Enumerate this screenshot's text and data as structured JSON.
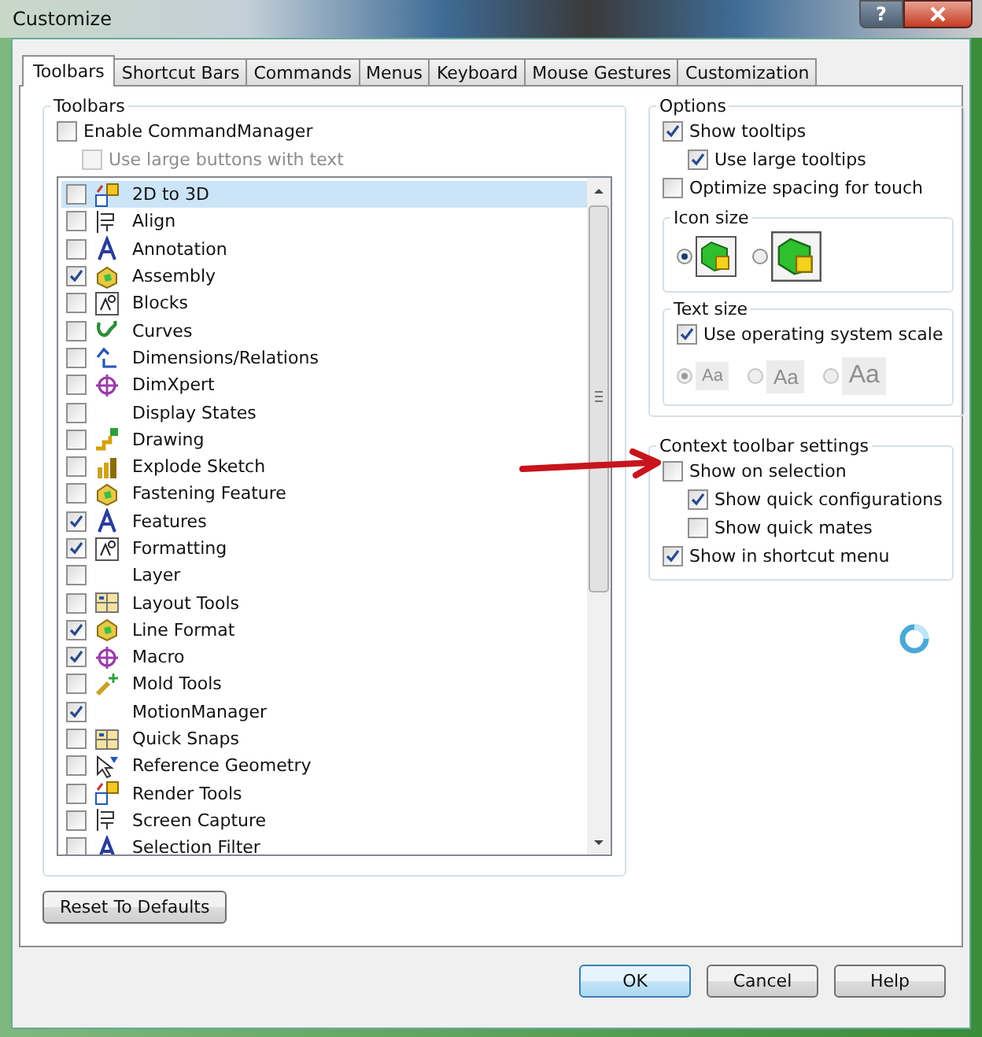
{
  "window": {
    "title": "Customize",
    "help_button": "?"
  },
  "tabs": [
    {
      "label": "Toolbars",
      "selected": true
    },
    {
      "label": "Shortcut Bars",
      "selected": false
    },
    {
      "label": "Commands",
      "selected": false
    },
    {
      "label": "Menus",
      "selected": false
    },
    {
      "label": "Keyboard",
      "selected": false
    },
    {
      "label": "Mouse Gestures",
      "selected": false
    },
    {
      "label": "Customization",
      "selected": false
    }
  ],
  "toolbars_group": {
    "title": "Toolbars",
    "options": [
      {
        "label": "Enable CommandManager",
        "checked": false,
        "disabled": false,
        "children": [
          {
            "label": "Use large buttons with text",
            "checked": false,
            "disabled": true
          }
        ]
      }
    ],
    "list": [
      {
        "label": "2D to 3D",
        "checked": false,
        "selected": true,
        "icon": true
      },
      {
        "label": "Align",
        "checked": false,
        "selected": false,
        "icon": true
      },
      {
        "label": "Annotation",
        "checked": false,
        "selected": false,
        "icon": true
      },
      {
        "label": "Assembly",
        "checked": true,
        "selected": false,
        "icon": true
      },
      {
        "label": "Blocks",
        "checked": false,
        "selected": false,
        "icon": true
      },
      {
        "label": "Curves",
        "checked": false,
        "selected": false,
        "icon": true
      },
      {
        "label": "Dimensions/Relations",
        "checked": false,
        "selected": false,
        "icon": true
      },
      {
        "label": "DimXpert",
        "checked": false,
        "selected": false,
        "icon": true
      },
      {
        "label": "Display States",
        "checked": false,
        "selected": false,
        "icon": false
      },
      {
        "label": "Drawing",
        "checked": false,
        "selected": false,
        "icon": true
      },
      {
        "label": "Explode Sketch",
        "checked": false,
        "selected": false,
        "icon": true
      },
      {
        "label": "Fastening Feature",
        "checked": false,
        "selected": false,
        "icon": true
      },
      {
        "label": "Features",
        "checked": true,
        "selected": false,
        "icon": true
      },
      {
        "label": "Formatting",
        "checked": true,
        "selected": false,
        "icon": true
      },
      {
        "label": "Layer",
        "checked": false,
        "selected": false,
        "icon": false
      },
      {
        "label": "Layout Tools",
        "checked": false,
        "selected": false,
        "icon": true
      },
      {
        "label": "Line Format",
        "checked": true,
        "selected": false,
        "icon": true
      },
      {
        "label": "Macro",
        "checked": true,
        "selected": false,
        "icon": true
      },
      {
        "label": "Mold Tools",
        "checked": false,
        "selected": false,
        "icon": true
      },
      {
        "label": "MotionManager",
        "checked": true,
        "selected": false,
        "icon": false
      },
      {
        "label": "Quick Snaps",
        "checked": false,
        "selected": false,
        "icon": true
      },
      {
        "label": "Reference Geometry",
        "checked": false,
        "selected": false,
        "icon": true
      },
      {
        "label": "Render Tools",
        "checked": false,
        "selected": false,
        "icon": true
      },
      {
        "label": "Screen Capture",
        "checked": false,
        "selected": false,
        "icon": true
      },
      {
        "label": "Selection Filter",
        "checked": false,
        "selected": false,
        "icon": true
      }
    ]
  },
  "options_group": {
    "title": "Options",
    "checkboxes": [
      {
        "label": "Show tooltips",
        "checked": true,
        "children": [
          {
            "label": "Use large tooltips",
            "checked": true
          }
        ]
      },
      {
        "label": "Optimize spacing for touch",
        "checked": false
      }
    ],
    "icon_size": {
      "title": "Icon size",
      "choices": [
        {
          "selected": true
        },
        {
          "selected": false
        }
      ]
    },
    "text_size": {
      "title": "Text size",
      "checkbox": {
        "label": "Use operating system scale",
        "checked": true
      },
      "choices": [
        {
          "label": "Aa",
          "selected": true,
          "disabled": true
        },
        {
          "label": "Aa",
          "selected": false,
          "disabled": true
        },
        {
          "label": "Aa",
          "selected": false,
          "disabled": true
        }
      ]
    }
  },
  "context_group": {
    "title": "Context toolbar settings",
    "checkboxes": [
      {
        "label": "Show on selection",
        "checked": false,
        "children": [
          {
            "label": "Show quick configurations",
            "checked": true
          },
          {
            "label": "Show quick mates",
            "checked": false
          }
        ]
      },
      {
        "label": "Show in shortcut menu",
        "checked": true
      }
    ]
  },
  "reset_button": "Reset To Defaults",
  "buttons": [
    {
      "label": "OK",
      "default": true
    },
    {
      "label": "Cancel",
      "default": false
    },
    {
      "label": "Help",
      "default": false
    }
  ]
}
